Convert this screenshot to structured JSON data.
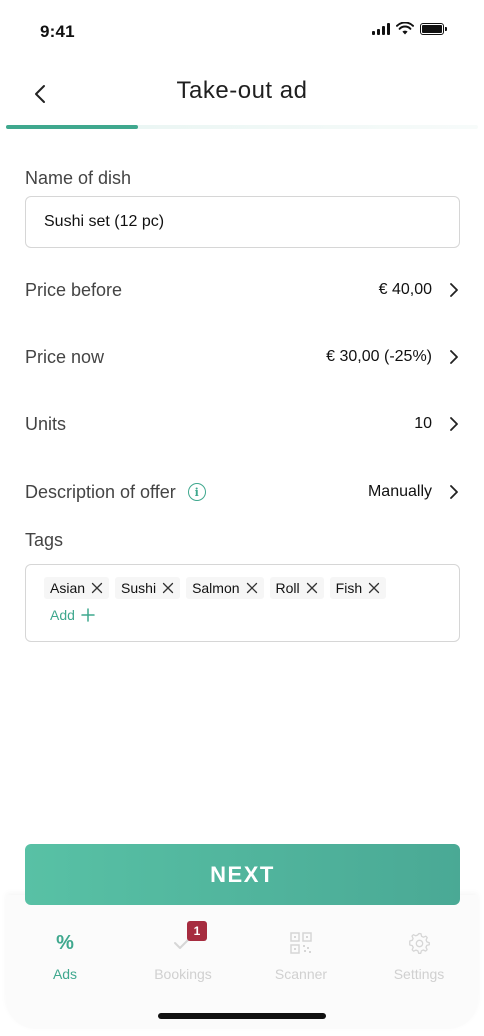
{
  "status": {
    "time": "9:41"
  },
  "header": {
    "title": "Take-out ad",
    "progress": 0.28
  },
  "form": {
    "dish": {
      "label": "Name of dish",
      "value": "Sushi set (12 pc)"
    },
    "price_before": {
      "label": "Price before",
      "value": "€ 40,00"
    },
    "price_now": {
      "label": "Price now",
      "value": "€ 30,00 (-25%)"
    },
    "units": {
      "label": "Units",
      "value": "10"
    },
    "description": {
      "label": "Description of offer",
      "value": "Manually"
    },
    "tags": {
      "label": "Tags",
      "items": [
        "Asian",
        "Sushi",
        "Salmon",
        "Roll",
        "Fish"
      ],
      "add_label": "Add"
    }
  },
  "next_label": "NEXT",
  "tabs": {
    "ads": {
      "label": "Ads",
      "icon_text": "%"
    },
    "bookings": {
      "label": "Bookings",
      "badge": "1"
    },
    "scanner": {
      "label": "Scanner"
    },
    "settings": {
      "label": "Settings"
    }
  },
  "colors": {
    "accent": "#3fa88e",
    "badge": "#a62c3f",
    "inactive": "#d0d0d0"
  }
}
